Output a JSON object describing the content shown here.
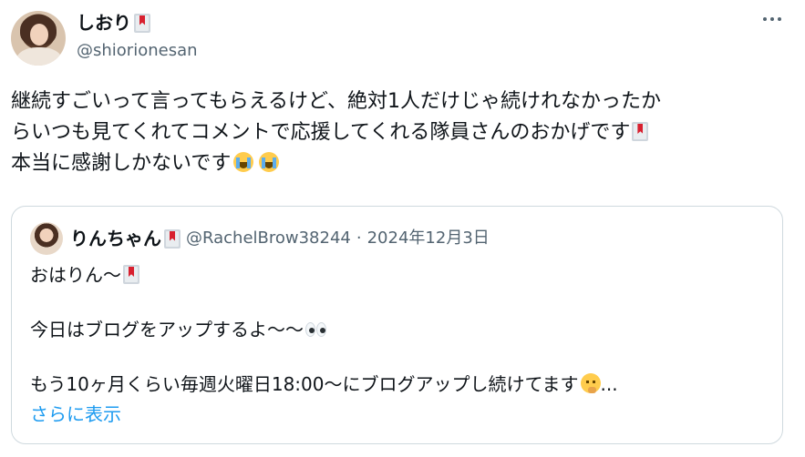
{
  "tweet": {
    "author": {
      "display_name": "しおり",
      "handle": "@shiorionesan",
      "avatar_icon": "profile-photo"
    },
    "text_lines": [
      "継続すごいって言ってもらえるけど、絶対1人だけじゃ続けれなかったか",
      "らいつも見てくれてコメントで応援してくれる隊員さんのおかげです",
      "本当に感謝しかないです"
    ],
    "emoji": {
      "book": "book-bookmark-icon",
      "cry": "loudly-crying-face-icon"
    },
    "menu_icon": "more-options-icon"
  },
  "quoted_tweet": {
    "author": {
      "display_name": "りんちゃん",
      "handle": "@RachelBrow38244",
      "separator": "·",
      "date": "2024年12月3日"
    },
    "lines": [
      "おはりん〜",
      "今日はブログをアップするよ〜〜",
      "もう10ヶ月くらい毎週火曜日18:00〜にブログアップし続けてます"
    ],
    "ellipsis": "...",
    "show_more": "さらに表示"
  },
  "colors": {
    "text": "#0f1419",
    "secondary": "#536471",
    "link": "#1d9bf0",
    "border": "#cfd9de"
  }
}
